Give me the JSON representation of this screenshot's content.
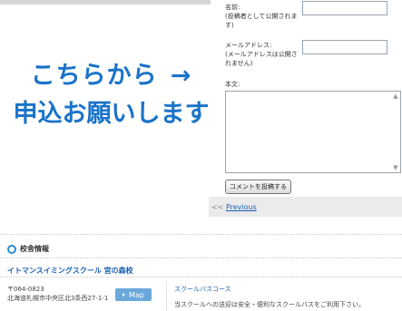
{
  "cta": {
    "line1": "こちらから",
    "arrow": "→",
    "line2": "申込お願いします",
    "color": "#1a73c8"
  },
  "comment_form": {
    "name_label": "名前:",
    "name_note_1": "(投稿者として公開されま",
    "name_note_2": "す)",
    "email_label": "メールアドレス:",
    "email_note_1": "(メールアドレスは公開さ",
    "email_note_2": "れません)",
    "body_label": "本文:",
    "submit_label": "コメントを投稿する"
  },
  "pagination": {
    "arrow": "<<",
    "previous_label": "Previous"
  },
  "school_info": {
    "heading": "校舎情報",
    "school_name": "イトマンスイミングスクール 宮の森校",
    "postal_code": "〒064-0823",
    "address": "北海道札幌市中央区北3条西27-1-1",
    "map_button": "Map",
    "bus_course_title": "スクールバスコース",
    "bus_text": "当スクールへの送迎は安全・便利なスクールバスをご利用下さい。"
  }
}
